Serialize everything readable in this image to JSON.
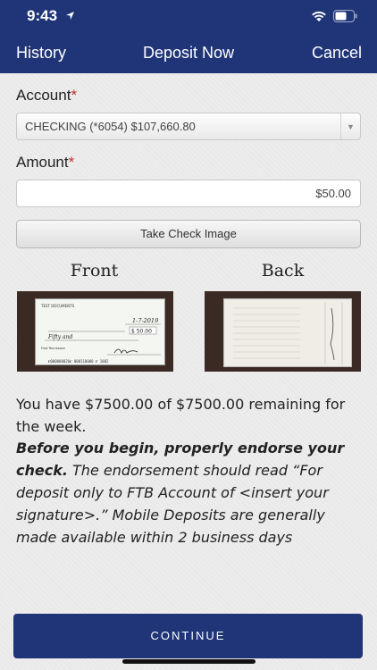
{
  "status": {
    "time": "9:43"
  },
  "nav": {
    "left": "History",
    "title": "Deposit Now",
    "right": "Cancel"
  },
  "form": {
    "account_label": "Account",
    "account_value": "CHECKING (*6054) $107,660.80",
    "amount_label": "Amount",
    "amount_value": "$50.00",
    "required_mark": "*",
    "take_image_label": "Take Check Image"
  },
  "check": {
    "front_label": "Front",
    "back_label": "Back",
    "front_header": "TEST DOCUMENTS",
    "front_date": "1-7-2019",
    "front_amount": "$ 50.00",
    "front_words": "Fifty and",
    "front_bank": "First Tennessee",
    "front_micr": "⑆000000026⑆ 000110000 ⑈ 1002"
  },
  "info": {
    "remaining": "You have $7500.00 of $7500.00 remaining for the week.",
    "endorse_bold": "Before you begin, properly endorse your check.",
    "endorse_rest": "The endorsement should read “For deposit only to FTB Account of <insert your signature>.” Mobile Deposits are generally made available within 2 business days"
  },
  "continue_label": "CONTINUE",
  "colors": {
    "primary": "#1f3578",
    "required": "#c0302e"
  }
}
